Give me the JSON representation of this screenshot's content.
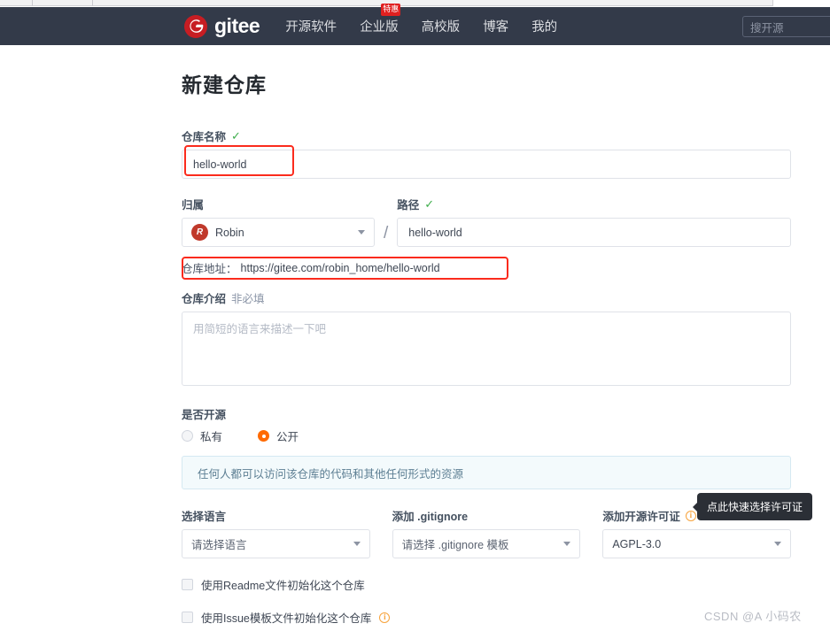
{
  "browser": {
    "chrome_visible": true
  },
  "topbar": {
    "brand_name": "gitee",
    "brand_icon": "gitee-logo-icon",
    "nav": [
      {
        "label": "开源软件",
        "badge": null
      },
      {
        "label": "企业版",
        "badge": "特惠"
      },
      {
        "label": "高校版",
        "badge": null
      },
      {
        "label": "博客",
        "badge": null
      },
      {
        "label": "我的",
        "badge": null
      }
    ],
    "search_placeholder": "搜开源"
  },
  "form": {
    "title": "新建仓库",
    "name_field": {
      "label": "仓库名称",
      "valid_mark": "✓",
      "value": "hello-world",
      "placeholder": ""
    },
    "owner_field": {
      "label": "归属",
      "selected": "Robin",
      "avatar_initial": "R"
    },
    "separator": "/",
    "path_field": {
      "label": "路径",
      "valid_mark": "✓",
      "value": "hello-world"
    },
    "repo_url": {
      "label": "仓库地址：",
      "value": "https://gitee.com/robin_home/hello-world"
    },
    "description_field": {
      "label": "仓库介绍",
      "optional": "非必填",
      "placeholder": "用简短的语言来描述一下吧",
      "value": ""
    },
    "visibility": {
      "label": "是否开源",
      "options": [
        {
          "label": "私有",
          "selected": false
        },
        {
          "label": "公开",
          "selected": true
        }
      ],
      "notice": "任何人都可以访问该仓库的代码和其他任何形式的资源"
    },
    "language_field": {
      "label": "选择语言",
      "selected": "请选择语言"
    },
    "gitignore_field": {
      "label": "添加 .gitignore",
      "selected": "请选择 .gitignore 模板"
    },
    "license_field": {
      "label": "添加开源许可证",
      "info_icon": "info-circle-icon",
      "selected": "AGPL-3.0",
      "tooltip": "点此快速选择许可证"
    },
    "checkboxes": [
      {
        "label": "使用Readme文件初始化这个仓库",
        "checked": false,
        "info": false
      },
      {
        "label": "使用Issue模板文件初始化这个仓库",
        "checked": false,
        "info": true
      }
    ]
  },
  "annotations": {
    "accent_red": "#fb2b1d",
    "accent_orange": "#ff6a00",
    "brand_red": "#c71d23",
    "topbar_bg": "#333a49"
  },
  "watermark": "CSDN @A 小码农"
}
